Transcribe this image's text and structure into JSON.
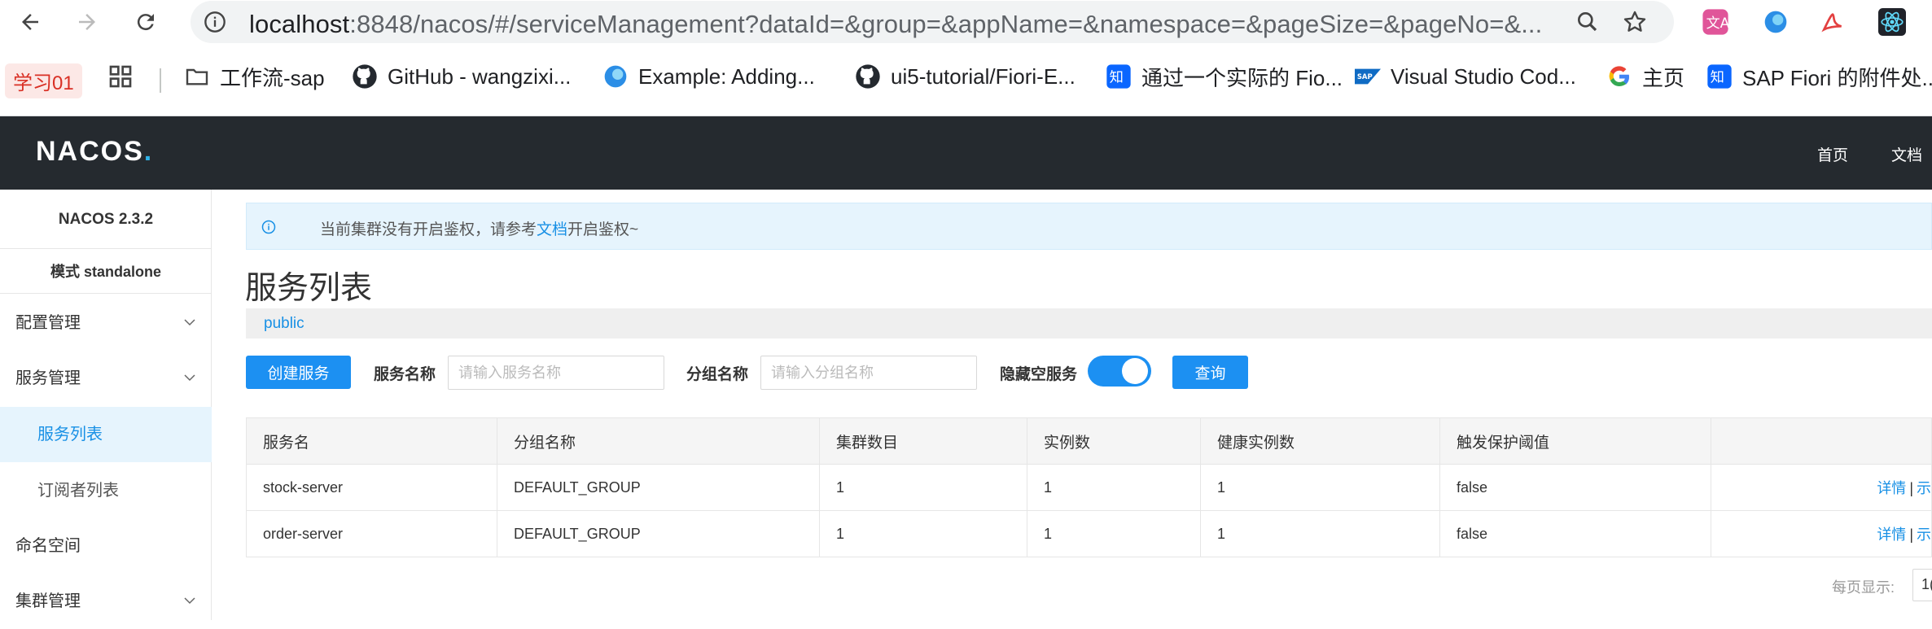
{
  "browser": {
    "url_host": "localhost",
    "url_rest": ":8848/nacos/#/serviceManagement?dataId=&group=&appName=&namespace=&pageSize=&pageNo=&...",
    "bookmarks": [
      {
        "label": "学习01"
      },
      {
        "label": "工作流-sap",
        "icon": "folder-icon"
      },
      {
        "label": "GitHub - wangzixi...",
        "icon": "github-icon"
      },
      {
        "label": "Example: Adding...",
        "icon": "globe-icon"
      },
      {
        "label": "ui5-tutorial/Fiori-E...",
        "icon": "github-icon"
      },
      {
        "label": "通过一个实际的 Fio...",
        "icon": "zhihu-icon"
      },
      {
        "label": "Visual Studio Cod...",
        "icon": "sap-icon"
      },
      {
        "label": "主页",
        "icon": "google-icon"
      },
      {
        "label": "SAP Fiori 的附件处...",
        "icon": "zhihu-icon"
      }
    ]
  },
  "header": {
    "logo": "NACOS",
    "logo_dot": ".",
    "nav": [
      "首页",
      "文档"
    ]
  },
  "sidebar": {
    "version": "NACOS 2.3.2",
    "mode": "模式 standalone",
    "items": [
      {
        "label": "配置管理"
      },
      {
        "label": "服务管理"
      },
      {
        "label": "服务列表"
      },
      {
        "label": "订阅者列表"
      },
      {
        "label": "命名空间"
      },
      {
        "label": "集群管理"
      }
    ]
  },
  "notice": {
    "before": "当前集群没有开启鉴权，请参考",
    "link": "文档",
    "after": "开启鉴权~"
  },
  "page": {
    "title": "服务列表",
    "namespace": "public"
  },
  "filters": {
    "create_button": "创建服务",
    "service_name_label": "服务名称",
    "service_name_placeholder": "请输入服务名称",
    "group_name_label": "分组名称",
    "group_name_placeholder": "请输入分组名称",
    "hide_empty_label": "隐藏空服务",
    "query_button": "查询"
  },
  "table": {
    "columns": [
      "服务名",
      "分组名称",
      "集群数目",
      "实例数",
      "健康实例数",
      "触发保护阈值",
      ""
    ],
    "rows": [
      {
        "name": "stock-server",
        "group": "DEFAULT_GROUP",
        "clusters": "1",
        "instances": "1",
        "healthy": "1",
        "threshold": "false",
        "detail": "详情",
        "more": "示"
      },
      {
        "name": "order-server",
        "group": "DEFAULT_GROUP",
        "clusters": "1",
        "instances": "1",
        "healthy": "1",
        "threshold": "false",
        "detail": "详情",
        "more": "示"
      }
    ]
  },
  "pager": {
    "label": "每页显示:",
    "value": "1("
  }
}
